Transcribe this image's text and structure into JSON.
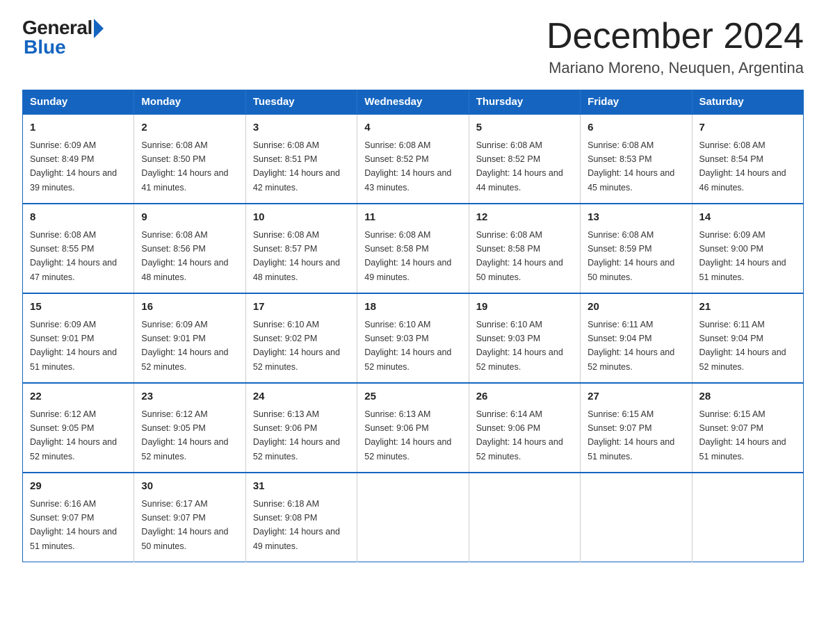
{
  "logo": {
    "general": "General",
    "blue": "Blue"
  },
  "title": "December 2024",
  "subtitle": "Mariano Moreno, Neuquen, Argentina",
  "days_of_week": [
    "Sunday",
    "Monday",
    "Tuesday",
    "Wednesday",
    "Thursday",
    "Friday",
    "Saturday"
  ],
  "weeks": [
    [
      {
        "day": "1",
        "sunrise": "6:09 AM",
        "sunset": "8:49 PM",
        "daylight": "14 hours and 39 minutes."
      },
      {
        "day": "2",
        "sunrise": "6:08 AM",
        "sunset": "8:50 PM",
        "daylight": "14 hours and 41 minutes."
      },
      {
        "day": "3",
        "sunrise": "6:08 AM",
        "sunset": "8:51 PM",
        "daylight": "14 hours and 42 minutes."
      },
      {
        "day": "4",
        "sunrise": "6:08 AM",
        "sunset": "8:52 PM",
        "daylight": "14 hours and 43 minutes."
      },
      {
        "day": "5",
        "sunrise": "6:08 AM",
        "sunset": "8:52 PM",
        "daylight": "14 hours and 44 minutes."
      },
      {
        "day": "6",
        "sunrise": "6:08 AM",
        "sunset": "8:53 PM",
        "daylight": "14 hours and 45 minutes."
      },
      {
        "day": "7",
        "sunrise": "6:08 AM",
        "sunset": "8:54 PM",
        "daylight": "14 hours and 46 minutes."
      }
    ],
    [
      {
        "day": "8",
        "sunrise": "6:08 AM",
        "sunset": "8:55 PM",
        "daylight": "14 hours and 47 minutes."
      },
      {
        "day": "9",
        "sunrise": "6:08 AM",
        "sunset": "8:56 PM",
        "daylight": "14 hours and 48 minutes."
      },
      {
        "day": "10",
        "sunrise": "6:08 AM",
        "sunset": "8:57 PM",
        "daylight": "14 hours and 48 minutes."
      },
      {
        "day": "11",
        "sunrise": "6:08 AM",
        "sunset": "8:58 PM",
        "daylight": "14 hours and 49 minutes."
      },
      {
        "day": "12",
        "sunrise": "6:08 AM",
        "sunset": "8:58 PM",
        "daylight": "14 hours and 50 minutes."
      },
      {
        "day": "13",
        "sunrise": "6:08 AM",
        "sunset": "8:59 PM",
        "daylight": "14 hours and 50 minutes."
      },
      {
        "day": "14",
        "sunrise": "6:09 AM",
        "sunset": "9:00 PM",
        "daylight": "14 hours and 51 minutes."
      }
    ],
    [
      {
        "day": "15",
        "sunrise": "6:09 AM",
        "sunset": "9:01 PM",
        "daylight": "14 hours and 51 minutes."
      },
      {
        "day": "16",
        "sunrise": "6:09 AM",
        "sunset": "9:01 PM",
        "daylight": "14 hours and 52 minutes."
      },
      {
        "day": "17",
        "sunrise": "6:10 AM",
        "sunset": "9:02 PM",
        "daylight": "14 hours and 52 minutes."
      },
      {
        "day": "18",
        "sunrise": "6:10 AM",
        "sunset": "9:03 PM",
        "daylight": "14 hours and 52 minutes."
      },
      {
        "day": "19",
        "sunrise": "6:10 AM",
        "sunset": "9:03 PM",
        "daylight": "14 hours and 52 minutes."
      },
      {
        "day": "20",
        "sunrise": "6:11 AM",
        "sunset": "9:04 PM",
        "daylight": "14 hours and 52 minutes."
      },
      {
        "day": "21",
        "sunrise": "6:11 AM",
        "sunset": "9:04 PM",
        "daylight": "14 hours and 52 minutes."
      }
    ],
    [
      {
        "day": "22",
        "sunrise": "6:12 AM",
        "sunset": "9:05 PM",
        "daylight": "14 hours and 52 minutes."
      },
      {
        "day": "23",
        "sunrise": "6:12 AM",
        "sunset": "9:05 PM",
        "daylight": "14 hours and 52 minutes."
      },
      {
        "day": "24",
        "sunrise": "6:13 AM",
        "sunset": "9:06 PM",
        "daylight": "14 hours and 52 minutes."
      },
      {
        "day": "25",
        "sunrise": "6:13 AM",
        "sunset": "9:06 PM",
        "daylight": "14 hours and 52 minutes."
      },
      {
        "day": "26",
        "sunrise": "6:14 AM",
        "sunset": "9:06 PM",
        "daylight": "14 hours and 52 minutes."
      },
      {
        "day": "27",
        "sunrise": "6:15 AM",
        "sunset": "9:07 PM",
        "daylight": "14 hours and 51 minutes."
      },
      {
        "day": "28",
        "sunrise": "6:15 AM",
        "sunset": "9:07 PM",
        "daylight": "14 hours and 51 minutes."
      }
    ],
    [
      {
        "day": "29",
        "sunrise": "6:16 AM",
        "sunset": "9:07 PM",
        "daylight": "14 hours and 51 minutes."
      },
      {
        "day": "30",
        "sunrise": "6:17 AM",
        "sunset": "9:07 PM",
        "daylight": "14 hours and 50 minutes."
      },
      {
        "day": "31",
        "sunrise": "6:18 AM",
        "sunset": "9:08 PM",
        "daylight": "14 hours and 49 minutes."
      },
      null,
      null,
      null,
      null
    ]
  ]
}
